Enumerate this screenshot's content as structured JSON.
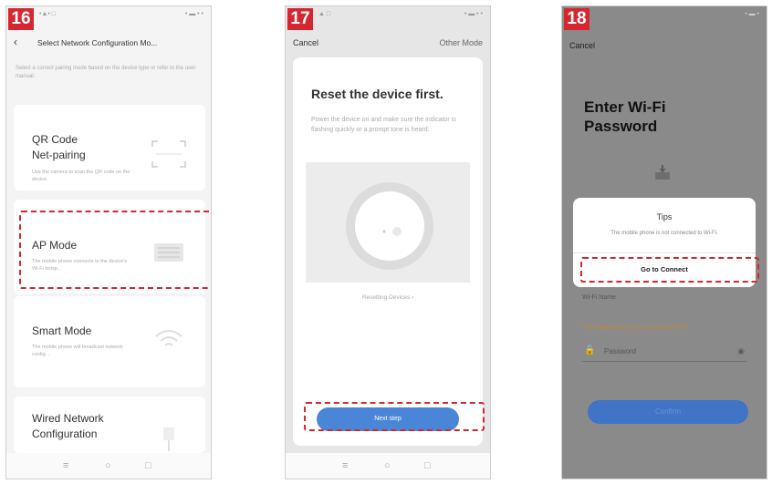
{
  "screen16": {
    "step": "16",
    "status_left": "•▲• □",
    "status_right": "• ▬ • •",
    "back": "‹",
    "title": "Select Network Configuration Mo...",
    "hint": "Select a correct pairing mode based on the device type or refer to the user manual.",
    "modes": [
      {
        "title1": "QR Code",
        "title2": "Net-pairing",
        "desc": "Use the camera to scan the QR code on the device."
      },
      {
        "title1": "AP Mode",
        "title2": "",
        "desc": "The mobile phone connects to the device's Wi-Fi hotsp..."
      },
      {
        "title1": "Smart Mode",
        "title2": "",
        "desc": "The mobile phone will broadcast network config..."
      },
      {
        "title1": "Wired Network",
        "title2": "Configuration",
        "desc": ""
      }
    ],
    "softkeys": [
      "≡",
      "○",
      "□"
    ],
    "highlight_color": "#d7262f"
  },
  "screen17": {
    "step": "17",
    "status_left": "▲ □",
    "status_right": "• ▬ • •",
    "cancel": "Cancel",
    "other_mode": "Other Mode",
    "title": "Reset the device first.",
    "desc": "Power the device on and make sure the indicator is flashing quickly or a prompt tone is heard.",
    "reset_link": "Resetting Devices ›",
    "next_button": "Next step",
    "softkeys": [
      "≡",
      "○",
      "□"
    ],
    "button_color": "#4a86d8"
  },
  "screen18": {
    "step": "18",
    "status_right": "• ▬ •",
    "cancel": "Cancel",
    "title_line1": "Enter Wi-Fi",
    "title_line2": "Password",
    "dialog_title": "Tips",
    "dialog_msg": "The mobile phone is not connected to Wi-Fi.",
    "dialog_button": "Go to Connect",
    "wifi_row": "Wi-Fi Name",
    "warning": "The mobile phone is not connected to Wi-Fi.",
    "password_placeholder": "Password",
    "confirm_button": "Confirm",
    "accent": "#3f74c6"
  }
}
